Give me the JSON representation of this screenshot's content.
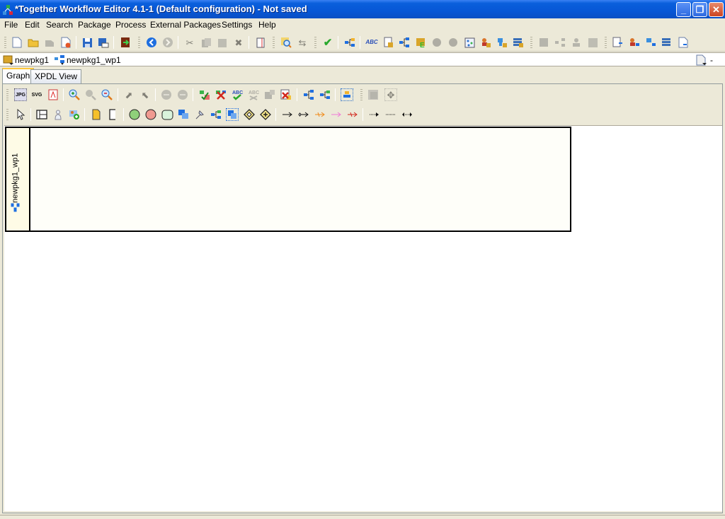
{
  "window": {
    "title": "*Together Workflow Editor 4.1-1 (Default configuration) - Not saved",
    "buttons": {
      "minimize": "_",
      "restore": "❐",
      "close": "✕"
    }
  },
  "menu": [
    "File",
    "Edit",
    "Search",
    "Package",
    "Process",
    "External Packages",
    "Settings",
    "Help"
  ],
  "main_toolbar": {
    "icons": [
      "new-file-icon",
      "open-folder-icon",
      "reopen-icon",
      "close-file-icon",
      "save-icon",
      "save-as-icon",
      "exit-icon",
      "back-icon",
      "forward-icon",
      "cut-icon",
      "copy-icon",
      "paste-icon",
      "delete-icon",
      "properties-icon",
      "find-icon",
      "references-icon",
      "check-icon",
      "process-tree-icon",
      "spell-check-icon",
      "package-properties-icon",
      "workflow-processes-icon",
      "external-package-icon",
      "participants-icon",
      "applications-icon",
      "type-declarations-icon",
      "data-fields-icon",
      "formal-parameters-icon",
      "package-icon",
      "activity-sets-icon",
      "process-tree-gray-icon",
      "activities-icon",
      "transitions-icon",
      "package-tree-icon",
      "participant-tree-icon",
      "application-tree-icon",
      "datafield-tree-icon",
      "document-tree-icon"
    ]
  },
  "pathbar": {
    "package": "newpkg1",
    "process": "newpkg1_wp1",
    "dropdown_label": "-"
  },
  "tabs": [
    {
      "label": "Graph",
      "active": true
    },
    {
      "label": "XPDL View",
      "active": false
    }
  ],
  "graph_toolbar": {
    "row1_icons": [
      "save-jpg-icon",
      "save-svg-icon",
      "save-pdf-icon",
      "zoom-in-icon",
      "actual-size-icon",
      "zoom-out-icon",
      "move-up-icon",
      "move-down-icon",
      "prev-icon",
      "next-icon",
      "insert-missing-icon",
      "remove-icon",
      "spell-check-icon",
      "spell-check-gray-icon",
      "activity-set-icon",
      "delete-element-icon",
      "process-layout-icon",
      "subflow-icon",
      "focus-icon",
      "overview-icon",
      "settings-icon"
    ],
    "row2_icons": [
      "select-icon",
      "swimlane-icon",
      "participant-icon",
      "add-participant-icon",
      "free-text-icon",
      "annotation-icon",
      "start-event-icon",
      "end-event-icon",
      "activity-icon",
      "subflow-activity-icon",
      "tool-activity-icon",
      "block-activity-icon",
      "route-icon",
      "gateway-icon",
      "gateway-plus-icon",
      "transition-icon",
      "conditional-transition-icon",
      "otherwise-transition-icon",
      "exception-transition-icon",
      "default-exception-transition-icon",
      "association-icon",
      "dotted-association-icon",
      "bidirectional-association-icon"
    ]
  },
  "canvas": {
    "lane_label": "newpkg1_wp1"
  }
}
